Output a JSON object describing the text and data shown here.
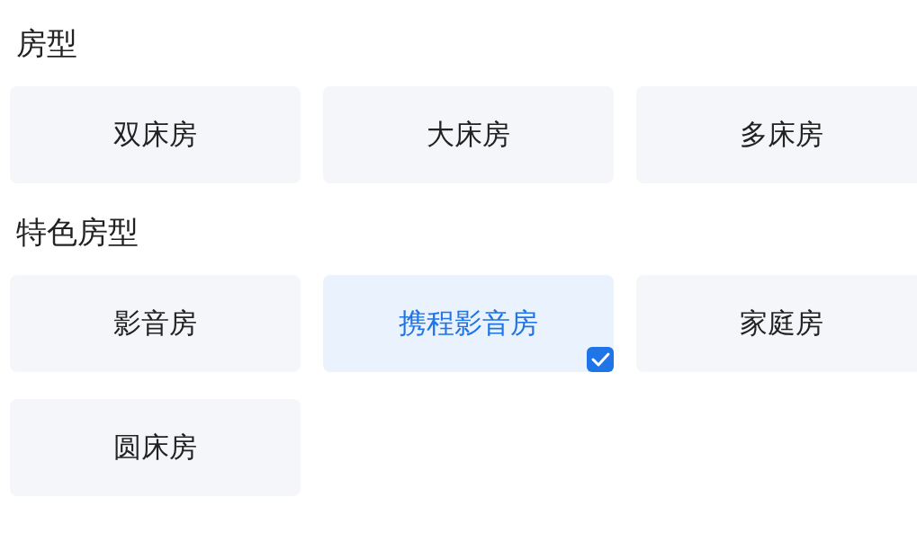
{
  "sections": [
    {
      "title": "房型",
      "options": [
        {
          "label": "双床房",
          "selected": false
        },
        {
          "label": "大床房",
          "selected": false
        },
        {
          "label": "多床房",
          "selected": false
        }
      ]
    },
    {
      "title": "特色房型",
      "options": [
        {
          "label": "影音房",
          "selected": false
        },
        {
          "label": "携程影音房",
          "selected": true
        },
        {
          "label": "家庭房",
          "selected": false
        },
        {
          "label": "圆床房",
          "selected": false
        }
      ]
    }
  ]
}
